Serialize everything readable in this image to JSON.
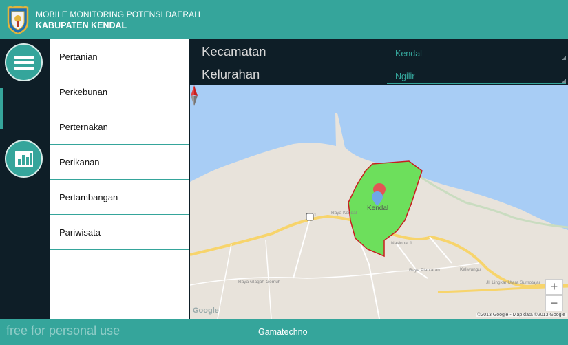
{
  "header": {
    "title_line1": "MOBILE MONITORING POTENSI DAERAH",
    "title_line2": "KABUPATEN KENDAL"
  },
  "rail": {
    "items": [
      {
        "icon": "menu-icon",
        "active": false
      },
      {
        "icon": "map-icon",
        "active": true
      },
      {
        "icon": "bar-chart-icon",
        "active": false
      }
    ]
  },
  "categories": {
    "items": [
      {
        "label": "Pertanian"
      },
      {
        "label": "Perkebunan"
      },
      {
        "label": "Perternakan"
      },
      {
        "label": "Perikanan"
      },
      {
        "label": "Pertambangan"
      },
      {
        "label": "Pariwisata"
      }
    ]
  },
  "filters": {
    "kecamatan_label": "Kecamatan",
    "kecamatan_value": "Kendal",
    "kelurahan_label": "Kelurahan",
    "kelurahan_value": "Ngilir"
  },
  "map": {
    "marker_label": "Kendal",
    "zoom_in": "+",
    "zoom_out": "−",
    "google_logo": "Google",
    "attribution": "©2013 Google - Map data ©2013 Google",
    "road_labels": {
      "raya_kendal": "Raya Kendal",
      "nasional": "Nasional 1",
      "raya_plantaran": "Raya Plantaran",
      "kaliwungu": "Kaliwungu",
      "raya_glagah": "Raya Glagah-Gemuh",
      "jl_lingkar": "Jl. Lingkar Utara Sumotajar",
      "route_number": "1"
    },
    "colors": {
      "sea": "#a8cdf5",
      "land": "#e8e3db",
      "region_fill": "#6ddf5c",
      "region_border": "#c81e1e",
      "road": "#f7d46b"
    }
  },
  "footer": {
    "watermark": "free for personal use",
    "credit": "Gamatechno"
  },
  "colors": {
    "accent": "#35a59b",
    "dark": "#0e1e27"
  }
}
